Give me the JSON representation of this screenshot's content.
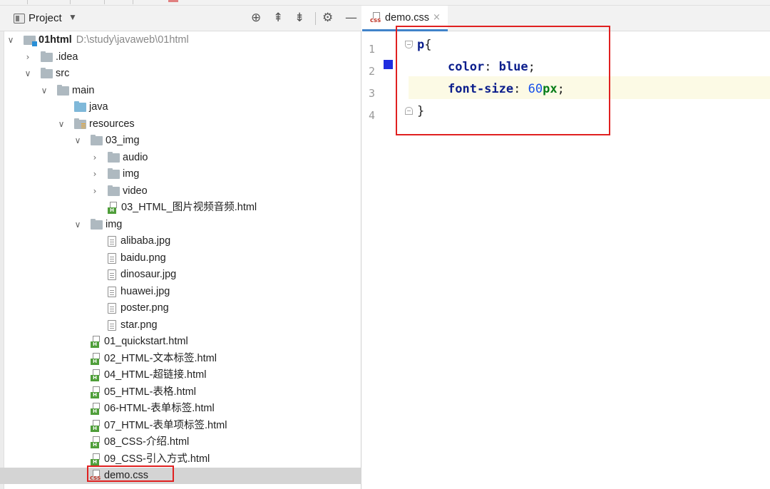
{
  "project_panel": {
    "title": "Project",
    "tree": [
      {
        "label": "01html",
        "note": "D:\\study\\javaweb\\01html",
        "depth": 0,
        "expanded": true,
        "icon": "module-folder-icon",
        "bold": true
      },
      {
        "label": ".idea",
        "depth": 1,
        "expanded": false,
        "icon": "folder-icon"
      },
      {
        "label": "src",
        "depth": 1,
        "expanded": true,
        "icon": "folder-icon"
      },
      {
        "label": "main",
        "depth": 2,
        "expanded": true,
        "icon": "folder-icon"
      },
      {
        "label": "java",
        "depth": 3,
        "icon": "source-folder-icon"
      },
      {
        "label": "resources",
        "depth": 3,
        "expanded": true,
        "icon": "resources-folder-icon"
      },
      {
        "label": "03_img",
        "depth": 4,
        "expanded": true,
        "icon": "folder-icon"
      },
      {
        "label": "audio",
        "depth": 5,
        "expanded": false,
        "icon": "folder-icon"
      },
      {
        "label": "img",
        "depth": 5,
        "expanded": false,
        "icon": "folder-icon"
      },
      {
        "label": "video",
        "depth": 5,
        "expanded": false,
        "icon": "folder-icon"
      },
      {
        "label": "03_HTML_图片视频音频.html",
        "depth": 5,
        "icon": "html-file-icon"
      },
      {
        "label": "img",
        "depth": 4,
        "expanded": true,
        "icon": "folder-icon"
      },
      {
        "label": "alibaba.jpg",
        "depth": 5,
        "icon": "image-file-icon"
      },
      {
        "label": "baidu.png",
        "depth": 5,
        "icon": "image-file-icon"
      },
      {
        "label": "dinosaur.jpg",
        "depth": 5,
        "icon": "image-file-icon"
      },
      {
        "label": "huawei.jpg",
        "depth": 5,
        "icon": "image-file-icon"
      },
      {
        "label": "poster.png",
        "depth": 5,
        "icon": "image-file-icon"
      },
      {
        "label": "star.png",
        "depth": 5,
        "icon": "image-file-icon"
      },
      {
        "label": "01_quickstart.html",
        "depth": 4,
        "icon": "html-file-icon"
      },
      {
        "label": "02_HTML-文本标签.html",
        "depth": 4,
        "icon": "html-file-icon"
      },
      {
        "label": "04_HTML-超链接.html",
        "depth": 4,
        "icon": "html-file-icon"
      },
      {
        "label": "05_HTML-表格.html",
        "depth": 4,
        "icon": "html-file-icon"
      },
      {
        "label": "06-HTML-表单标签.html",
        "depth": 4,
        "icon": "html-file-icon"
      },
      {
        "label": "07_HTML-表单项标签.html",
        "depth": 4,
        "icon": "html-file-icon"
      },
      {
        "label": "08_CSS-介绍.html",
        "depth": 4,
        "icon": "html-file-icon"
      },
      {
        "label": "09_CSS-引入方式.html",
        "depth": 4,
        "icon": "html-file-icon"
      },
      {
        "label": "demo.css",
        "depth": 4,
        "icon": "css-file-icon",
        "selected": true
      }
    ]
  },
  "editor": {
    "tab_label": "demo.css",
    "line_numbers": [
      "1",
      "2",
      "3",
      "4"
    ],
    "code": {
      "selector": "p",
      "open_brace": "{",
      "prop1": "color",
      "value1": "blue",
      "prop2": "font-size",
      "value2_num": "60",
      "value2_unit": "px",
      "close_brace": "}"
    }
  },
  "colors": {
    "selection": "#d4d4d4",
    "annotation_red": "#e02020",
    "change_marker": "#1f2ddf",
    "current_line": "#fcfae5",
    "tab_underline": "#4083c9"
  }
}
